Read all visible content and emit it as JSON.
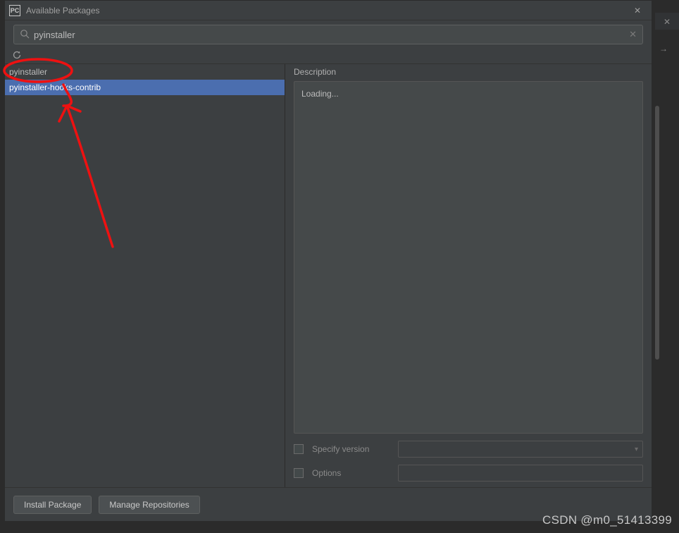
{
  "window": {
    "title": "Available Packages",
    "app_icon_text": "PC"
  },
  "search": {
    "value": "pyinstaller"
  },
  "packages": [
    {
      "name": "pyinstaller",
      "selected": false
    },
    {
      "name": "pyinstaller-hooks-contrib",
      "selected": true
    }
  ],
  "description": {
    "label": "Description",
    "loading_text": "Loading..."
  },
  "options": {
    "specify_version_label": "Specify version",
    "options_label": "Options"
  },
  "footer": {
    "install_label": "Install Package",
    "manage_label": "Manage Repositories"
  },
  "watermark": "CSDN @m0_51413399"
}
